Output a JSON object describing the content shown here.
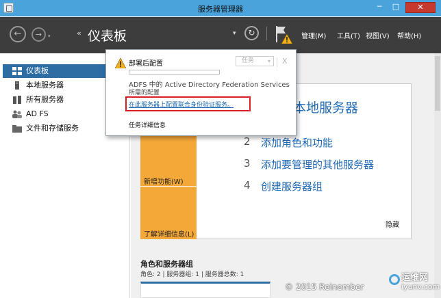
{
  "window": {
    "title": "服务器管理器",
    "min_label": "─",
    "max_label": "□",
    "close_label": "✕"
  },
  "header": {
    "back_label": "←",
    "forward_label": "→",
    "crumb_arrows": "‹‹",
    "title": "仪表板",
    "dropdown_caret": "▾",
    "refresh_label": "↻",
    "menus": [
      "管理(M)",
      "工具(T)",
      "视图(V)",
      "帮助(H)"
    ]
  },
  "sidebar": {
    "items": [
      {
        "label": "仪表板",
        "icon": "dashboard-icon"
      },
      {
        "label": "本地服务器",
        "icon": "local-server-icon"
      },
      {
        "label": "所有服务器",
        "icon": "all-servers-icon"
      },
      {
        "label": "AD FS",
        "icon": "adfs-users-icon"
      },
      {
        "label": "文件和存储服务",
        "icon": "file-storage-icon"
      }
    ]
  },
  "welcome": {
    "title_partial": "本地服务器",
    "steps": [
      {
        "num": "2",
        "label": "添加角色和功能"
      },
      {
        "num": "3",
        "label": "添加要管理的其他服务器"
      },
      {
        "num": "4",
        "label": "创建服务器组"
      }
    ],
    "new_features": "新增功能(W)",
    "learn_more": "了解详细信息(L)",
    "hide": "隐藏"
  },
  "roles": {
    "title": "角色和服务器组",
    "subtitle": "角色: 2 | 服务器组: 1 | 服务器总数: 1"
  },
  "notification": {
    "title": "部署后配置",
    "task_label": "任务",
    "task_caret": "▾",
    "close_label": "X",
    "progress": 0,
    "desc_line1": "ADFS 中的 Active Directory Federation Services",
    "desc_line2": "所需的配置",
    "link": "在此服务器上配置联合身份验证服务。",
    "details": "任务详细信息"
  },
  "watermark": {
    "text": "© 2015 Reinember",
    "logo_cn": "运维网",
    "logo_en": "iyunv.com"
  },
  "colors": {
    "titlebar": "#4aa3da",
    "command_bar": "#3d3d3d",
    "active_item": "#2e6da4",
    "accent_orange": "#f4a838",
    "link_blue": "#1f6bb5",
    "highlight_red": "#d61f26",
    "close_red": "#c6392f"
  }
}
